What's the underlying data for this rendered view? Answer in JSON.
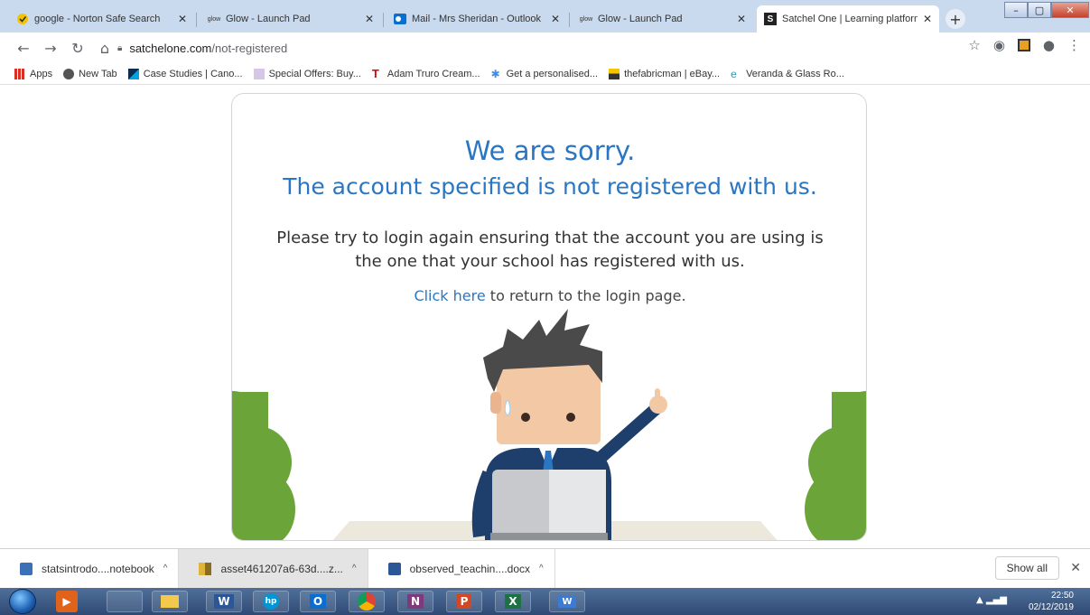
{
  "tabs": [
    {
      "title": "google - Norton Safe Search",
      "icon": "norton-check-icon",
      "active": false
    },
    {
      "title": "Glow - Launch Pad",
      "icon": "glow-icon",
      "active": false
    },
    {
      "title": "Mail - Mrs Sheridan - Outlook",
      "icon": "outlook-icon",
      "active": false
    },
    {
      "title": "Glow - Launch Pad",
      "icon": "glow-icon",
      "active": false
    },
    {
      "title": "Satchel One | Learning platform",
      "icon": "satchel-s-icon",
      "active": true
    }
  ],
  "glow_badge": "glow",
  "address": {
    "host": "satchelone.com",
    "path": "/not-registered"
  },
  "bookmarks": [
    {
      "label": "Apps",
      "icon": "apps-grid-icon"
    },
    {
      "label": "New Tab",
      "icon": "globe-icon"
    },
    {
      "label": "Case Studies | Cano...",
      "icon": "canon-icon"
    },
    {
      "label": "Special Offers: Buy...",
      "icon": "offers-icon"
    },
    {
      "label": "Adam Truro Cream...",
      "icon": "letter-t-icon"
    },
    {
      "label": "Get a personalised...",
      "icon": "sparkle-icon"
    },
    {
      "label": "thefabricman | eBay...",
      "icon": "shop-icon"
    },
    {
      "label": "Veranda & Glass Ro...",
      "icon": "ie-icon"
    }
  ],
  "page": {
    "heading": "We are sorry.",
    "subheading": "The account specified is not registered with us.",
    "message": "Please try to login again ensuring that the account you are using is the one that your school has registered with us.",
    "link_text": "Click here",
    "link_suffix": " to return to the login page."
  },
  "downloads": [
    {
      "name": "statsintrodo....notebook",
      "icon": "notebook-file-icon"
    },
    {
      "name": "asset461207a6-63d....z...",
      "icon": "zip-file-icon"
    },
    {
      "name": "observed_teachin....docx",
      "icon": "word-file-icon"
    }
  ],
  "shelf": {
    "show_all": "Show all"
  },
  "taskbar": {
    "apps": [
      "media-player",
      "explorer-window",
      "file-explorer",
      "word",
      "hp",
      "outlook",
      "chrome",
      "onenote",
      "powerpoint",
      "excel",
      "wordpad"
    ],
    "time": "22:50",
    "date": "02/12/2019"
  },
  "colors": {
    "accent": "#2b76c2",
    "heading": "#2b76c2"
  }
}
